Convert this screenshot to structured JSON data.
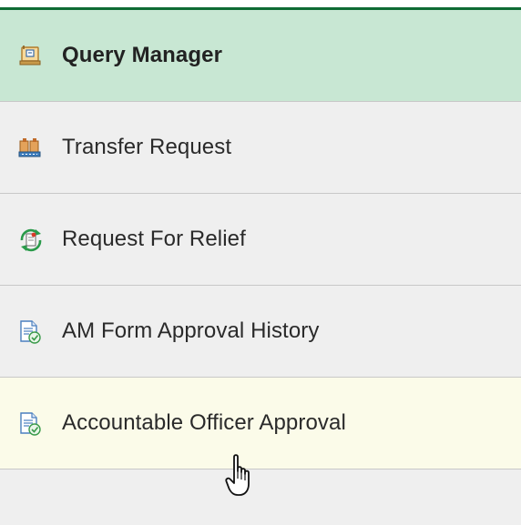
{
  "menu": {
    "items": [
      {
        "label": "Query Manager",
        "icon": "query-manager-icon",
        "state": "active"
      },
      {
        "label": "Transfer Request",
        "icon": "transfer-request-icon",
        "state": "normal"
      },
      {
        "label": "Request For Relief",
        "icon": "refresh-document-icon",
        "state": "normal"
      },
      {
        "label": "AM Form Approval History",
        "icon": "document-approval-icon",
        "state": "normal"
      },
      {
        "label": "Accountable Officer Approval",
        "icon": "document-approval-icon",
        "state": "hover"
      }
    ]
  },
  "colors": {
    "accent": "#0e6b34",
    "active_bg": "#c8e7d3",
    "hover_bg": "#fbfbe9",
    "menu_bg": "#efefef",
    "divider": "#c8c8c8"
  }
}
